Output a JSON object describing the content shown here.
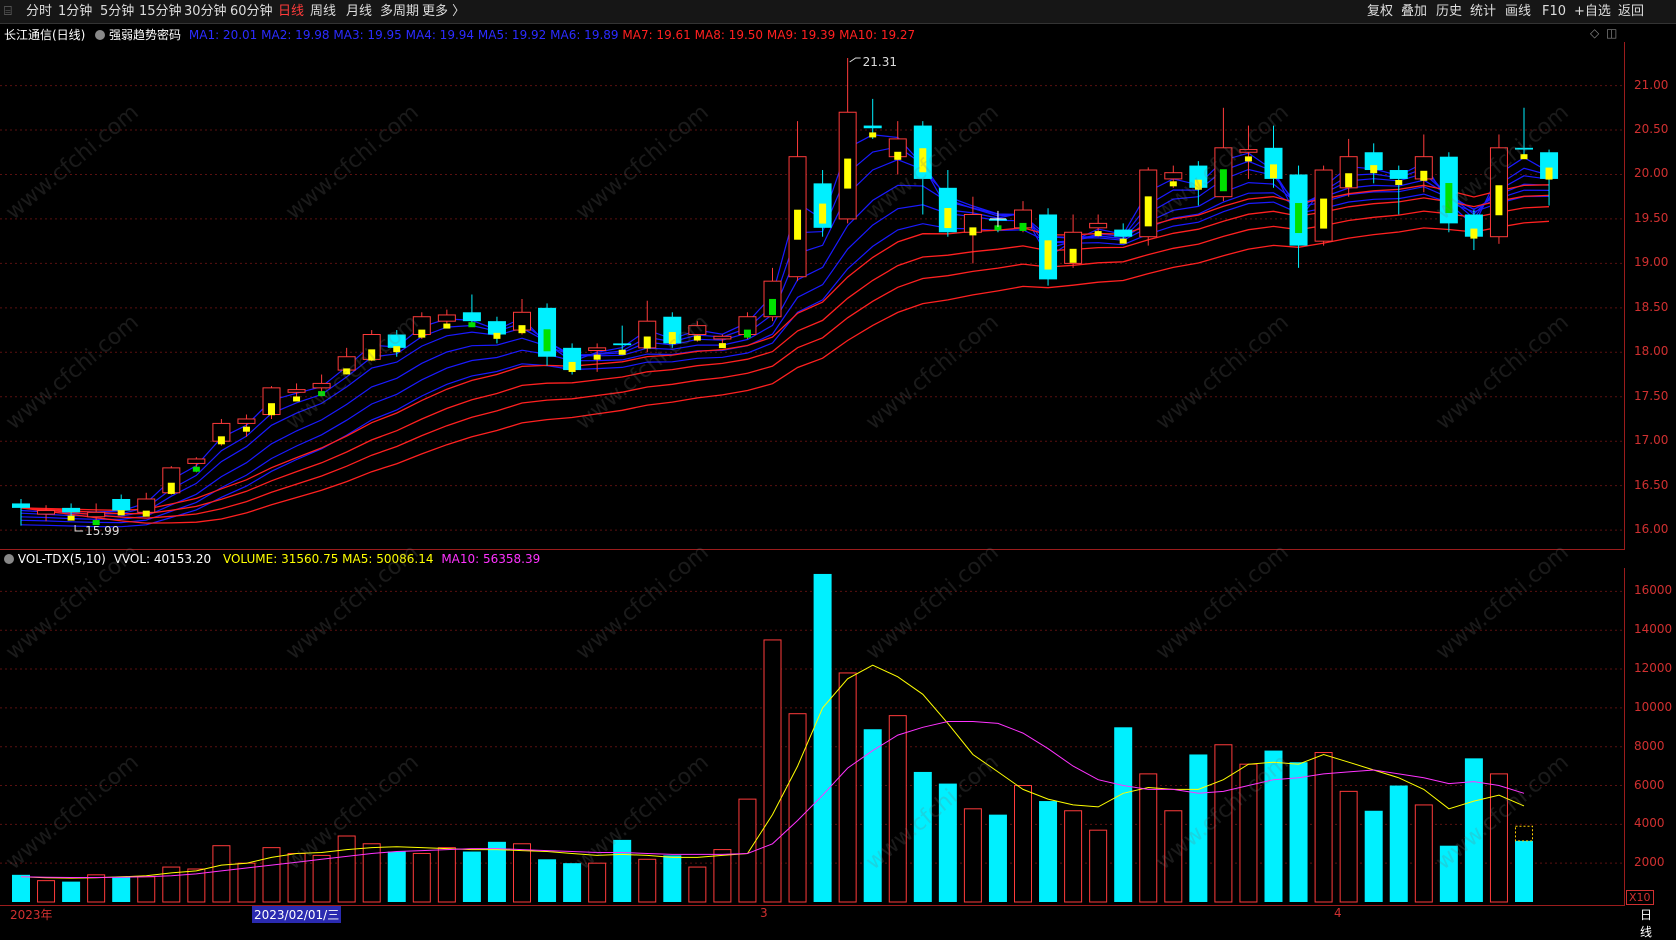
{
  "topbar": {
    "menu_icon": "menu-icon",
    "periods": [
      "分时",
      "1分钟",
      "5分钟",
      "15分钟",
      "30分钟",
      "60分钟",
      "日线",
      "周线",
      "月线",
      "多周期",
      "更多 〉"
    ],
    "active_period": "日线",
    "tools": [
      "复权",
      "叠加",
      "历史",
      "统计",
      "画线",
      "F10",
      "+自选",
      "返回"
    ]
  },
  "main": {
    "stock_title": "长江通信(日线)",
    "indicator_name": "强弱趋势密码",
    "ma_blue": [
      "MA1: 20.01",
      "MA2: 19.98",
      "MA3: 19.95",
      "MA4: 19.94",
      "MA5: 19.92",
      "MA6: 19.89"
    ],
    "ma_red": [
      "MA7: 19.61",
      "MA8: 19.50",
      "MA9: 19.39",
      "MA10: 19.27"
    ],
    "high_label": "21.31",
    "low_label": "15.99",
    "y_ticks": [
      "21.00",
      "20.50",
      "20.00",
      "19.50",
      "19.00",
      "18.50",
      "18.00",
      "17.50",
      "17.00",
      "16.50",
      "16.00"
    ],
    "colors": {
      "up": "#ff3b3b",
      "down": "#00f0ff",
      "ma_blue": "#1a1aff",
      "ma_red": "#ff2020",
      "mid_yellow": "#ffff00",
      "mid_green": "#00e000"
    }
  },
  "volume": {
    "indicator": "VOL-TDX(5,10)",
    "vvol": "VVOL: 40153.20",
    "volume": "VOLUME: 31560.75",
    "ma5": "MA5: 50086.14",
    "ma10": "MA10: 56358.39",
    "y_ticks": [
      "16000",
      "14000",
      "12000",
      "10000",
      "8000",
      "6000",
      "4000",
      "2000"
    ],
    "unit": "X10"
  },
  "xaxis": {
    "labels": [
      "2023年",
      "2023/02/01/三",
      "3",
      "4"
    ],
    "period": "日线"
  },
  "watermark": "www.cfchi.com",
  "chart_data": {
    "type": "candlestick",
    "title": "长江通信(日线)",
    "ylim": [
      15.9,
      21.4
    ],
    "candles": [
      [
        16.3,
        16.25,
        16.35,
        16.05
      ],
      [
        16.18,
        16.22,
        16.28,
        16.1
      ],
      [
        16.25,
        16.2,
        16.3,
        16.12
      ],
      [
        16.15,
        16.2,
        16.3,
        16.1
      ],
      [
        16.35,
        16.22,
        16.4,
        16.18
      ],
      [
        16.2,
        16.35,
        16.42,
        16.18
      ],
      [
        16.42,
        16.7,
        16.72,
        16.4
      ],
      [
        16.75,
        16.8,
        16.82,
        16.65
      ],
      [
        17.0,
        17.2,
        17.25,
        16.95
      ],
      [
        17.2,
        17.25,
        17.3,
        17.05
      ],
      [
        17.3,
        17.6,
        17.62,
        17.25
      ],
      [
        17.55,
        17.58,
        17.65,
        17.5
      ],
      [
        17.6,
        17.65,
        17.75,
        17.55
      ],
      [
        17.8,
        17.95,
        18.05,
        17.75
      ],
      [
        17.92,
        18.2,
        18.25,
        17.9
      ],
      [
        18.2,
        18.05,
        18.25,
        17.95
      ],
      [
        18.2,
        18.4,
        18.45,
        18.15
      ],
      [
        18.35,
        18.42,
        18.48,
        18.3
      ],
      [
        18.45,
        18.35,
        18.65,
        18.3
      ],
      [
        18.35,
        18.2,
        18.4,
        18.1
      ],
      [
        18.25,
        18.45,
        18.6,
        18.2
      ],
      [
        18.5,
        17.95,
        18.55,
        17.85
      ],
      [
        18.05,
        17.8,
        18.1,
        17.75
      ],
      [
        18.02,
        18.05,
        18.1,
        17.78
      ],
      [
        18.1,
        18.08,
        18.3,
        18.0
      ],
      [
        18.05,
        18.35,
        18.58,
        18.0
      ],
      [
        18.4,
        18.1,
        18.45,
        18.05
      ],
      [
        18.2,
        18.3,
        18.35,
        18.12
      ],
      [
        18.15,
        18.18,
        18.2,
        18.1
      ],
      [
        18.2,
        18.4,
        18.45,
        18.15
      ],
      [
        18.4,
        18.8,
        18.95,
        18.35
      ],
      [
        18.85,
        20.2,
        20.6,
        18.8
      ],
      [
        19.9,
        19.4,
        20.05,
        19.3
      ],
      [
        19.5,
        20.7,
        21.31,
        19.45
      ],
      [
        20.55,
        20.52,
        20.85,
        20.4
      ],
      [
        20.2,
        20.4,
        20.6,
        20.0
      ],
      [
        20.55,
        19.95,
        20.6,
        19.55
      ],
      [
        19.85,
        19.35,
        20.05,
        19.3
      ],
      [
        19.35,
        19.55,
        19.75,
        19.0
      ],
      [
        19.5,
        19.48,
        19.55,
        19.35
      ],
      [
        19.4,
        19.6,
        19.7,
        19.35
      ],
      [
        19.55,
        18.82,
        19.62,
        18.75
      ],
      [
        19.0,
        19.35,
        19.55,
        18.95
      ],
      [
        19.4,
        19.45,
        19.55,
        19.3
      ],
      [
        19.38,
        19.3,
        19.45,
        19.25
      ],
      [
        19.3,
        20.05,
        20.08,
        19.2
      ],
      [
        19.95,
        20.02,
        20.1,
        19.85
      ],
      [
        20.1,
        19.85,
        20.15,
        19.65
      ],
      [
        19.75,
        20.3,
        20.75,
        19.7
      ],
      [
        20.25,
        20.28,
        20.55,
        19.95
      ],
      [
        20.3,
        19.95,
        20.55,
        19.85
      ],
      [
        20.0,
        19.2,
        20.1,
        18.95
      ],
      [
        19.25,
        20.05,
        20.1,
        19.2
      ],
      [
        19.85,
        20.2,
        20.4,
        19.75
      ],
      [
        20.25,
        20.05,
        20.35,
        19.9
      ],
      [
        20.05,
        19.95,
        20.1,
        19.55
      ],
      [
        19.95,
        20.2,
        20.45,
        19.8
      ],
      [
        20.2,
        19.45,
        20.25,
        19.35
      ],
      [
        19.55,
        19.3,
        19.6,
        19.15
      ],
      [
        19.3,
        20.3,
        20.45,
        19.22
      ],
      [
        20.3,
        20.28,
        20.75,
        20.2
      ],
      [
        20.25,
        19.95,
        20.28,
        19.65
      ]
    ],
    "volumes": [
      1400,
      1100,
      1050,
      1400,
      1300,
      1300,
      1800,
      1700,
      2900,
      2000,
      2800,
      2500,
      2400,
      3400,
      3000,
      2600,
      2500,
      2800,
      2600,
      3100,
      3000,
      2200,
      2000,
      2000,
      3200,
      2200,
      2400,
      1800,
      2700,
      5300,
      13500,
      9700,
      16900,
      11800,
      8900,
      9600,
      6700,
      6100,
      4800,
      4500,
      6000,
      5200,
      4700,
      3700,
      9000,
      6600,
      4700,
      7600,
      8100,
      7100,
      7800,
      7200,
      7700,
      5700,
      4700,
      6000,
      5000,
      2900,
      7400,
      6600,
      3150
    ],
    "vol_ma5": [
      1300,
      1250,
      1230,
      1250,
      1300,
      1350,
      1500,
      1600,
      1900,
      2000,
      2300,
      2500,
      2550,
      2700,
      2800,
      2850,
      2800,
      2750,
      2700,
      2700,
      2650,
      2600,
      2500,
      2400,
      2450,
      2400,
      2300,
      2300,
      2400,
      2500,
      4500,
      7000,
      10000,
      11500,
      12200,
      11600,
      10700,
      9200,
      7600,
      6700,
      5800,
      5300,
      5000,
      4900,
      5600,
      5900,
      5800,
      5800,
      6300,
      7100,
      7200,
      7100,
      7600,
      7200,
      6800,
      6400,
      5800,
      4800,
      5200,
      5500,
      4950
    ],
    "vol_ma10": [
      1300,
      1280,
      1260,
      1260,
      1280,
      1300,
      1350,
      1450,
      1600,
      1750,
      1900,
      2050,
      2200,
      2350,
      2500,
      2600,
      2650,
      2700,
      2750,
      2750,
      2700,
      2650,
      2600,
      2550,
      2550,
      2500,
      2450,
      2450,
      2450,
      2500,
      3000,
      4200,
      5500,
      6900,
      7800,
      8600,
      9000,
      9300,
      9300,
      9200,
      8700,
      7900,
      7000,
      6300,
      6000,
      5800,
      5800,
      5600,
      5700,
      6000,
      6300,
      6400,
      6600,
      6700,
      6800,
      6600,
      6400,
      6100,
      6200,
      6000,
      5600
    ]
  }
}
